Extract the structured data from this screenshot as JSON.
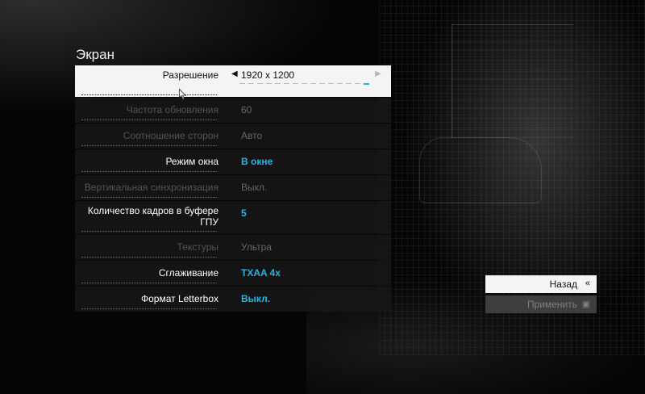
{
  "page": {
    "title": "Экран"
  },
  "settings": [
    {
      "label": "Разрешение",
      "value": "1920 x 1200",
      "state": "selected",
      "accent": false,
      "slider": {
        "count": 15,
        "active": 14
      }
    },
    {
      "label": "Частота обновления",
      "value": "60",
      "state": "disabled",
      "accent": false
    },
    {
      "label": "Соотношение сторон",
      "value": "Авто",
      "state": "disabled",
      "accent": false
    },
    {
      "label": "Режим окна",
      "value": "В окне",
      "state": "normal",
      "accent": true
    },
    {
      "label": "Вертикальная синхронизация",
      "value": "Выкл.",
      "state": "disabled",
      "accent": false
    },
    {
      "label": "Количество кадров в буфере ГПУ",
      "value": "5",
      "state": "normal",
      "accent": true,
      "tall": true
    },
    {
      "label": "Текстуры",
      "value": "Ультра",
      "state": "disabled",
      "accent": false
    },
    {
      "label": "Сглаживание",
      "value": "TXAA 4x",
      "state": "normal",
      "accent": true
    },
    {
      "label": "Формат Letterbox",
      "value": "Выкл.",
      "state": "normal",
      "accent": true
    }
  ],
  "buttons": {
    "back": {
      "label": "Назад",
      "icon": "double-chevron-left-icon"
    },
    "apply": {
      "label": "Применить",
      "icon": "apply-box-icon"
    }
  },
  "colors": {
    "accent": "#23b5e6",
    "selected_bg": "#f4f4f4",
    "row_bg": "#181818"
  }
}
